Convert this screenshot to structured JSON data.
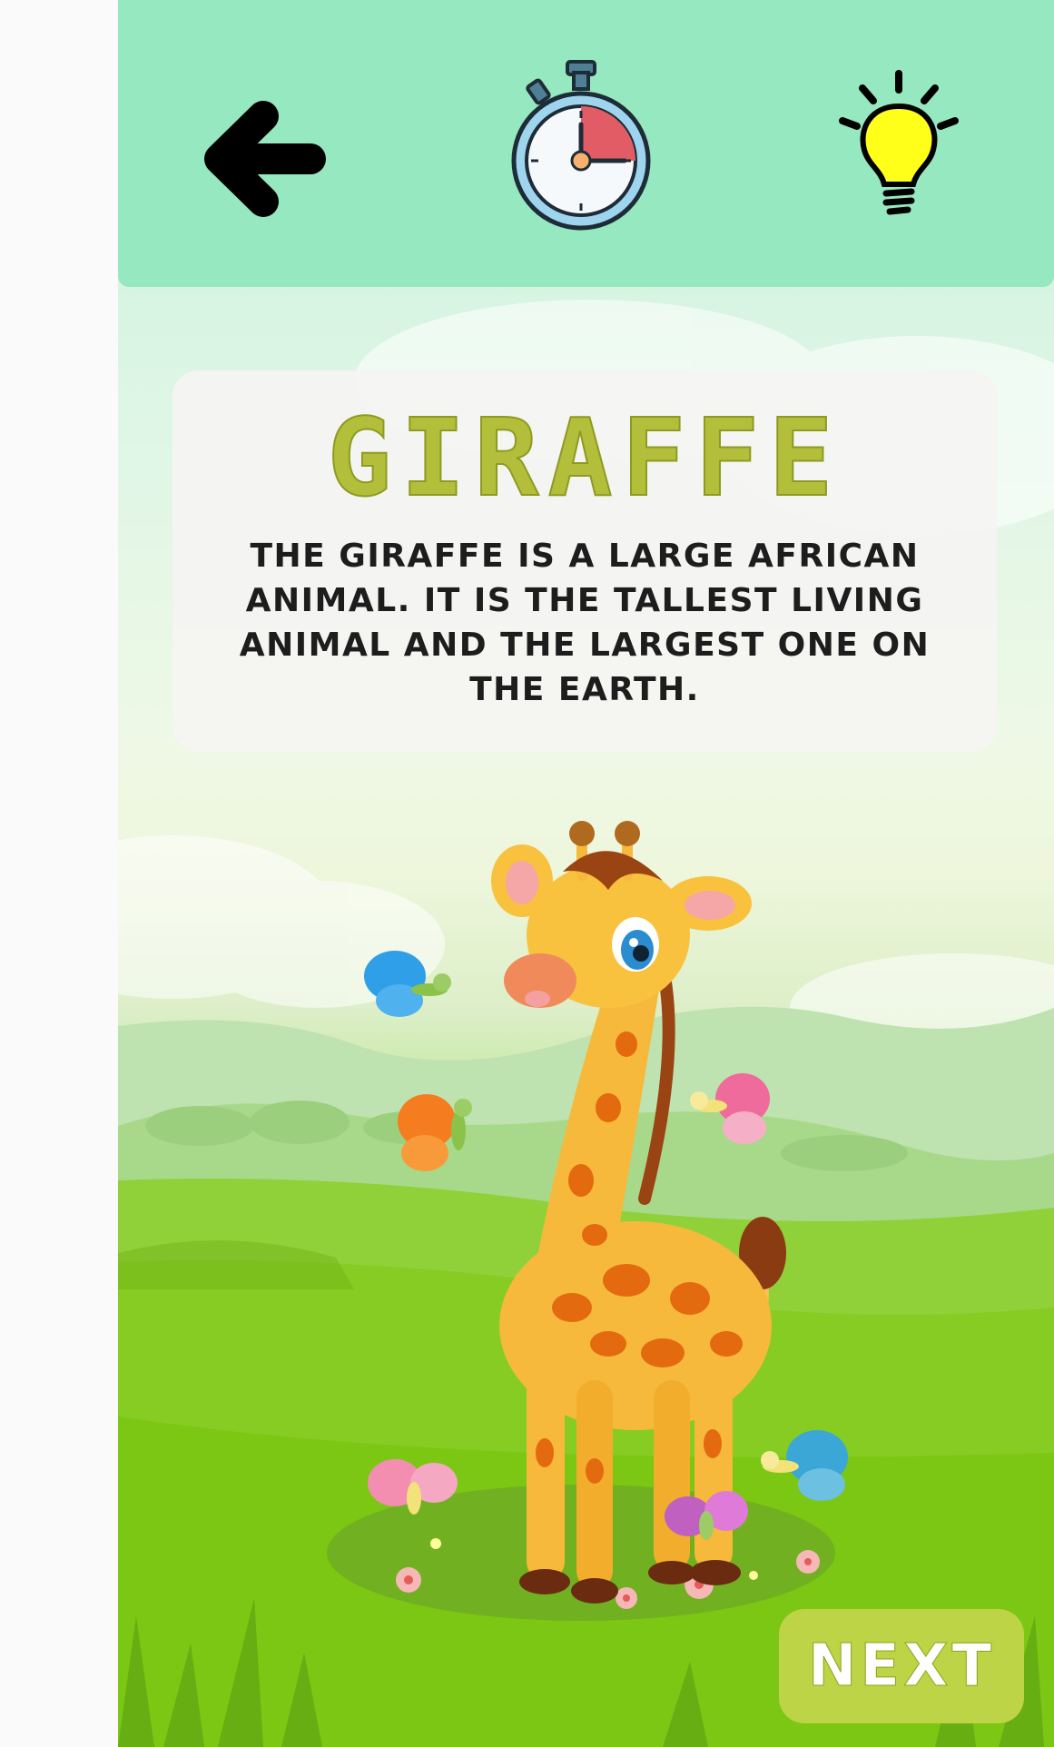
{
  "header": {
    "back_icon": "arrow-left-icon",
    "timer_icon": "stopwatch-icon",
    "hint_icon": "lightbulb-icon"
  },
  "card": {
    "title": "GIRAFFE",
    "description": "THE GIRAFFE IS A LARGE AFRICAN ANIMAL. IT IS THE TALLEST LIVING ANIMAL AND THE LARGEST ONE ON THE EARTH."
  },
  "illustration": {
    "subject": "giraffe-illustration"
  },
  "footer": {
    "next_label": "NEXT"
  },
  "colors": {
    "header_bg": "#95e8bf",
    "title": "#b3bf3b",
    "next_button": "#bcd445",
    "grass": "#7ecb18"
  }
}
